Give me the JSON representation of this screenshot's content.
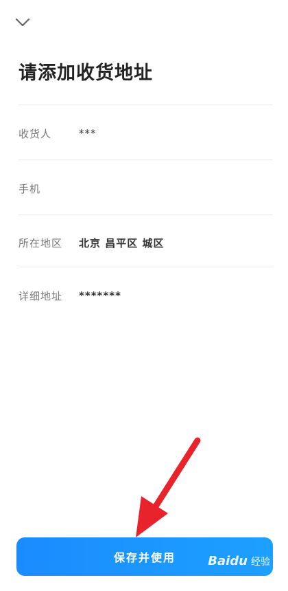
{
  "title": "请添加收货地址",
  "form": {
    "rows": [
      {
        "label": "收货人",
        "value": "***"
      },
      {
        "label": "手机",
        "value": ""
      },
      {
        "label": "所在地区",
        "value": "北京 昌平区 城区"
      },
      {
        "label": "详细地址",
        "value": "*******"
      }
    ]
  },
  "submit_label": "保存并使用",
  "icons": {
    "back": "chevron-down-icon",
    "annotation": "red-arrow"
  },
  "colors": {
    "button": "#1a8cff",
    "arrow": "#e8232b"
  },
  "watermark": {
    "brand": "Baidu",
    "suffix": "经验"
  }
}
